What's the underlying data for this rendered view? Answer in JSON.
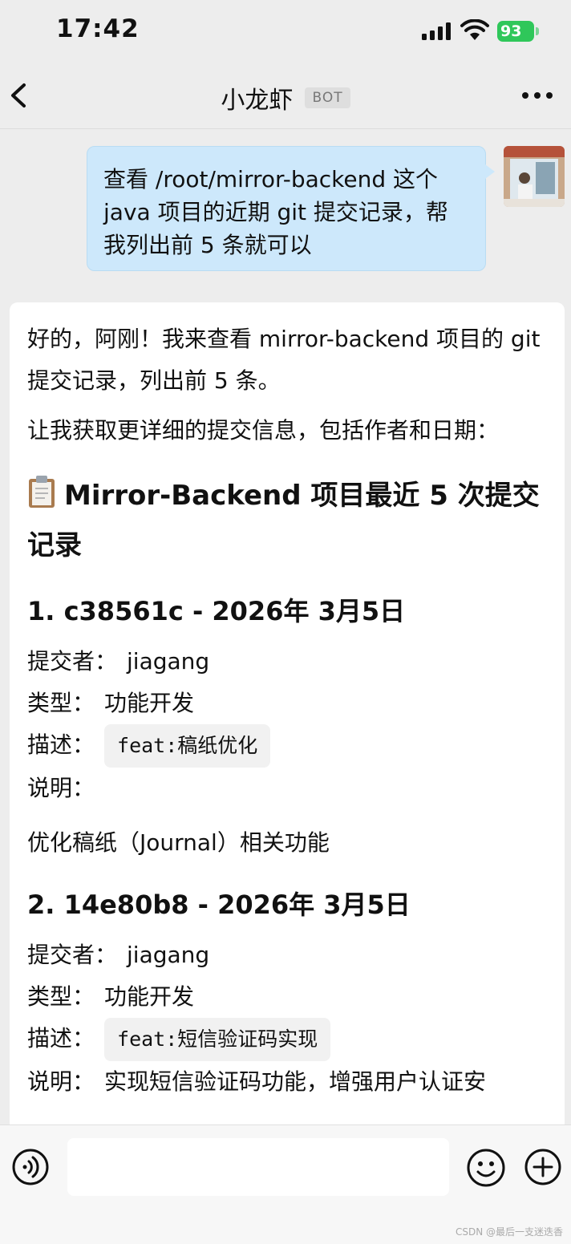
{
  "status_bar": {
    "time": "17:42",
    "battery": "93"
  },
  "nav": {
    "title": "小龙虾",
    "badge": "BOT"
  },
  "user_message": "查看 /root/mirror-backend 这个 java 项目的近期 git 提交记录，帮我列出前 5 条就可以",
  "bot_message": {
    "intro": "好的，阿刚！我来查看 mirror-backend 项目的 git 提交记录，列出前 5 条。",
    "fetch_note": "让我获取更详细的提交信息，包括作者和日期：",
    "heading": "Mirror-Backend 项目最近 5 次提交记录",
    "commits": [
      {
        "title": "1. c38561c - 2026年 3月5日",
        "committer_label": "提交者：",
        "committer": "jiagang",
        "type_label": "类型：",
        "type": "功能开发",
        "desc_label": "描述：",
        "desc": "feat:稿纸优化",
        "note_label": "说明：",
        "note": "优化稿纸（Journal）相关功能"
      },
      {
        "title": "2. 14e80b8 - 2026年 3月5日",
        "committer_label": "提交者：",
        "committer": "jiagang",
        "type_label": "类型：",
        "type": "功能开发",
        "desc_label": "描述：",
        "desc": "feat:短信验证码实现",
        "note_label": "说明：",
        "note": "实现短信验证码功能，增强用户认证安"
      }
    ]
  },
  "watermark": "CSDN @最后一支迷迭香",
  "colors": {
    "user_bubble": "#cde8fb",
    "battery": "#2fc75a",
    "background": "#ededed"
  }
}
